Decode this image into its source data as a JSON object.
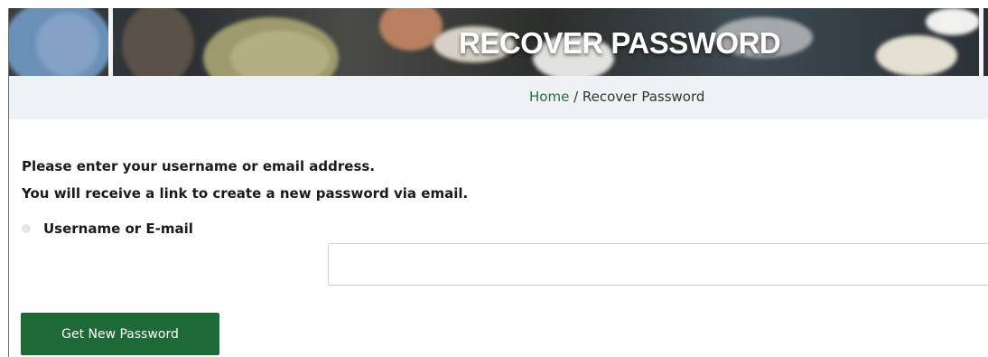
{
  "hero": {
    "title": "RECOVER PASSWORD"
  },
  "breadcrumb": {
    "home_label": "Home",
    "separator": " / ",
    "current_label": "Recover Password"
  },
  "form": {
    "instruction_line1": "Please enter your username or email address.",
    "instruction_line2": "You will receive a link to create a new password via email.",
    "field_label": "Username or E-mail",
    "field_value": "",
    "field_placeholder": "",
    "submit_label": "Get New Password"
  },
  "colors": {
    "accent_green": "#1e6a36",
    "link_green": "#2a6b3c",
    "crumb_bar_bg": "#eef2f5"
  }
}
